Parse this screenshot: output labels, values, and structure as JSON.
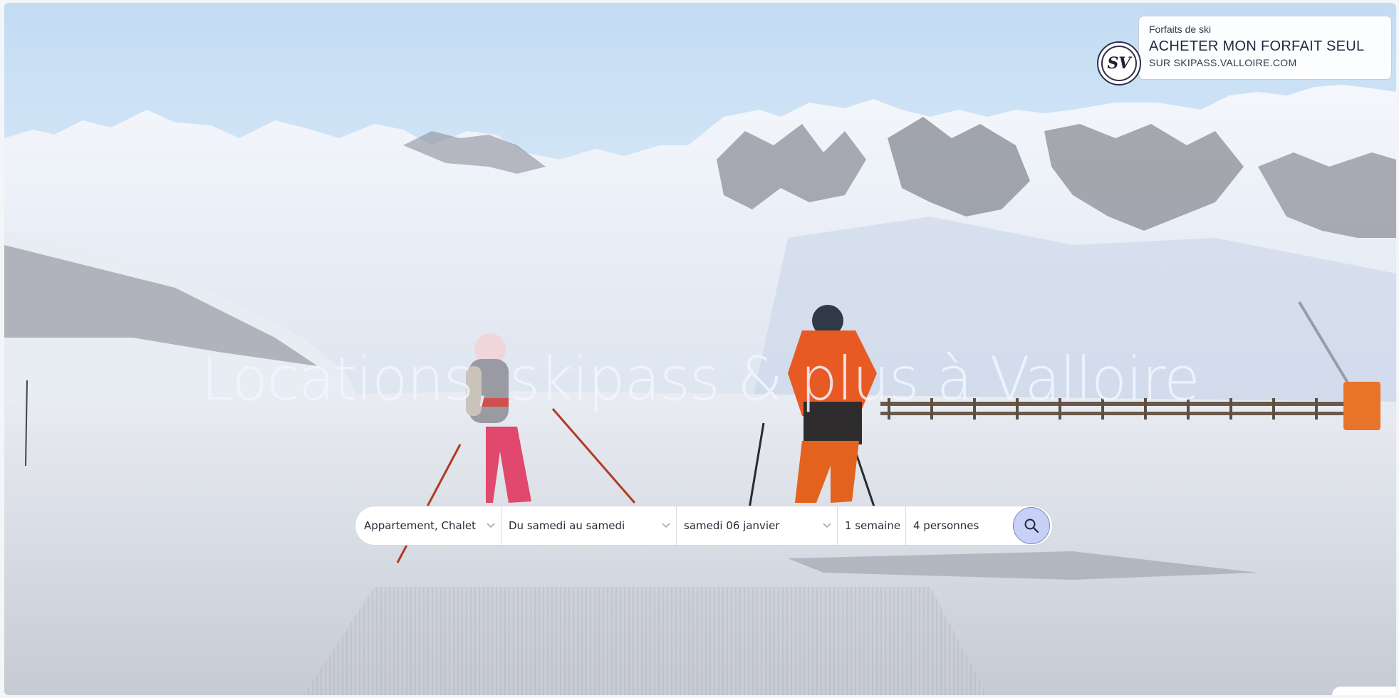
{
  "hero": {
    "title": "Locations, skipass & plus à Valloire"
  },
  "promo": {
    "logo_text": "SV",
    "label": "Forfaits de ski",
    "cta": "ACHETER MON FORFAIT SEUL",
    "sub": "SUR SKIPASS.VALLOIRE.COM"
  },
  "search": {
    "type": "Appartement, Chalet",
    "period": "Du samedi au samedi",
    "date": "samedi 06 janvier",
    "duration": "1 semaine",
    "people": "4 personnes"
  },
  "icons": {
    "search": "search-icon",
    "chevron": "chevron-down-icon",
    "logo": "skipass-logo"
  },
  "colors": {
    "search_button": "#c7d0f7",
    "sky_top": "#bcd6f0",
    "snow": "#f4f6fa"
  }
}
